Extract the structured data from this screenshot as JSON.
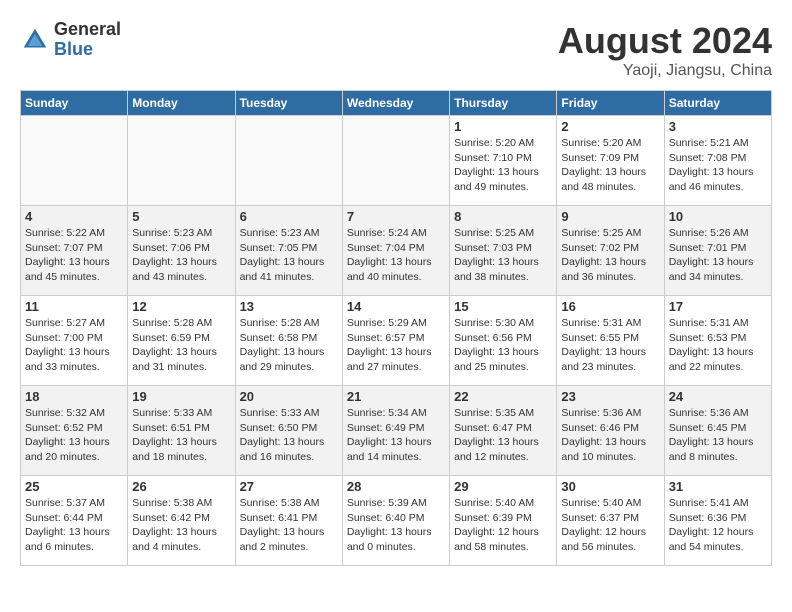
{
  "header": {
    "logo_general": "General",
    "logo_blue": "Blue",
    "month_year": "August 2024",
    "location": "Yaoji, Jiangsu, China"
  },
  "weekdays": [
    "Sunday",
    "Monday",
    "Tuesday",
    "Wednesday",
    "Thursday",
    "Friday",
    "Saturday"
  ],
  "weeks": [
    [
      {
        "day": "",
        "info": ""
      },
      {
        "day": "",
        "info": ""
      },
      {
        "day": "",
        "info": ""
      },
      {
        "day": "",
        "info": ""
      },
      {
        "day": "1",
        "info": "Sunrise: 5:20 AM\nSunset: 7:10 PM\nDaylight: 13 hours\nand 49 minutes."
      },
      {
        "day": "2",
        "info": "Sunrise: 5:20 AM\nSunset: 7:09 PM\nDaylight: 13 hours\nand 48 minutes."
      },
      {
        "day": "3",
        "info": "Sunrise: 5:21 AM\nSunset: 7:08 PM\nDaylight: 13 hours\nand 46 minutes."
      }
    ],
    [
      {
        "day": "4",
        "info": "Sunrise: 5:22 AM\nSunset: 7:07 PM\nDaylight: 13 hours\nand 45 minutes."
      },
      {
        "day": "5",
        "info": "Sunrise: 5:23 AM\nSunset: 7:06 PM\nDaylight: 13 hours\nand 43 minutes."
      },
      {
        "day": "6",
        "info": "Sunrise: 5:23 AM\nSunset: 7:05 PM\nDaylight: 13 hours\nand 41 minutes."
      },
      {
        "day": "7",
        "info": "Sunrise: 5:24 AM\nSunset: 7:04 PM\nDaylight: 13 hours\nand 40 minutes."
      },
      {
        "day": "8",
        "info": "Sunrise: 5:25 AM\nSunset: 7:03 PM\nDaylight: 13 hours\nand 38 minutes."
      },
      {
        "day": "9",
        "info": "Sunrise: 5:25 AM\nSunset: 7:02 PM\nDaylight: 13 hours\nand 36 minutes."
      },
      {
        "day": "10",
        "info": "Sunrise: 5:26 AM\nSunset: 7:01 PM\nDaylight: 13 hours\nand 34 minutes."
      }
    ],
    [
      {
        "day": "11",
        "info": "Sunrise: 5:27 AM\nSunset: 7:00 PM\nDaylight: 13 hours\nand 33 minutes."
      },
      {
        "day": "12",
        "info": "Sunrise: 5:28 AM\nSunset: 6:59 PM\nDaylight: 13 hours\nand 31 minutes."
      },
      {
        "day": "13",
        "info": "Sunrise: 5:28 AM\nSunset: 6:58 PM\nDaylight: 13 hours\nand 29 minutes."
      },
      {
        "day": "14",
        "info": "Sunrise: 5:29 AM\nSunset: 6:57 PM\nDaylight: 13 hours\nand 27 minutes."
      },
      {
        "day": "15",
        "info": "Sunrise: 5:30 AM\nSunset: 6:56 PM\nDaylight: 13 hours\nand 25 minutes."
      },
      {
        "day": "16",
        "info": "Sunrise: 5:31 AM\nSunset: 6:55 PM\nDaylight: 13 hours\nand 23 minutes."
      },
      {
        "day": "17",
        "info": "Sunrise: 5:31 AM\nSunset: 6:53 PM\nDaylight: 13 hours\nand 22 minutes."
      }
    ],
    [
      {
        "day": "18",
        "info": "Sunrise: 5:32 AM\nSunset: 6:52 PM\nDaylight: 13 hours\nand 20 minutes."
      },
      {
        "day": "19",
        "info": "Sunrise: 5:33 AM\nSunset: 6:51 PM\nDaylight: 13 hours\nand 18 minutes."
      },
      {
        "day": "20",
        "info": "Sunrise: 5:33 AM\nSunset: 6:50 PM\nDaylight: 13 hours\nand 16 minutes."
      },
      {
        "day": "21",
        "info": "Sunrise: 5:34 AM\nSunset: 6:49 PM\nDaylight: 13 hours\nand 14 minutes."
      },
      {
        "day": "22",
        "info": "Sunrise: 5:35 AM\nSunset: 6:47 PM\nDaylight: 13 hours\nand 12 minutes."
      },
      {
        "day": "23",
        "info": "Sunrise: 5:36 AM\nSunset: 6:46 PM\nDaylight: 13 hours\nand 10 minutes."
      },
      {
        "day": "24",
        "info": "Sunrise: 5:36 AM\nSunset: 6:45 PM\nDaylight: 13 hours\nand 8 minutes."
      }
    ],
    [
      {
        "day": "25",
        "info": "Sunrise: 5:37 AM\nSunset: 6:44 PM\nDaylight: 13 hours\nand 6 minutes."
      },
      {
        "day": "26",
        "info": "Sunrise: 5:38 AM\nSunset: 6:42 PM\nDaylight: 13 hours\nand 4 minutes."
      },
      {
        "day": "27",
        "info": "Sunrise: 5:38 AM\nSunset: 6:41 PM\nDaylight: 13 hours\nand 2 minutes."
      },
      {
        "day": "28",
        "info": "Sunrise: 5:39 AM\nSunset: 6:40 PM\nDaylight: 13 hours\nand 0 minutes."
      },
      {
        "day": "29",
        "info": "Sunrise: 5:40 AM\nSunset: 6:39 PM\nDaylight: 12 hours\nand 58 minutes."
      },
      {
        "day": "30",
        "info": "Sunrise: 5:40 AM\nSunset: 6:37 PM\nDaylight: 12 hours\nand 56 minutes."
      },
      {
        "day": "31",
        "info": "Sunrise: 5:41 AM\nSunset: 6:36 PM\nDaylight: 12 hours\nand 54 minutes."
      }
    ]
  ]
}
